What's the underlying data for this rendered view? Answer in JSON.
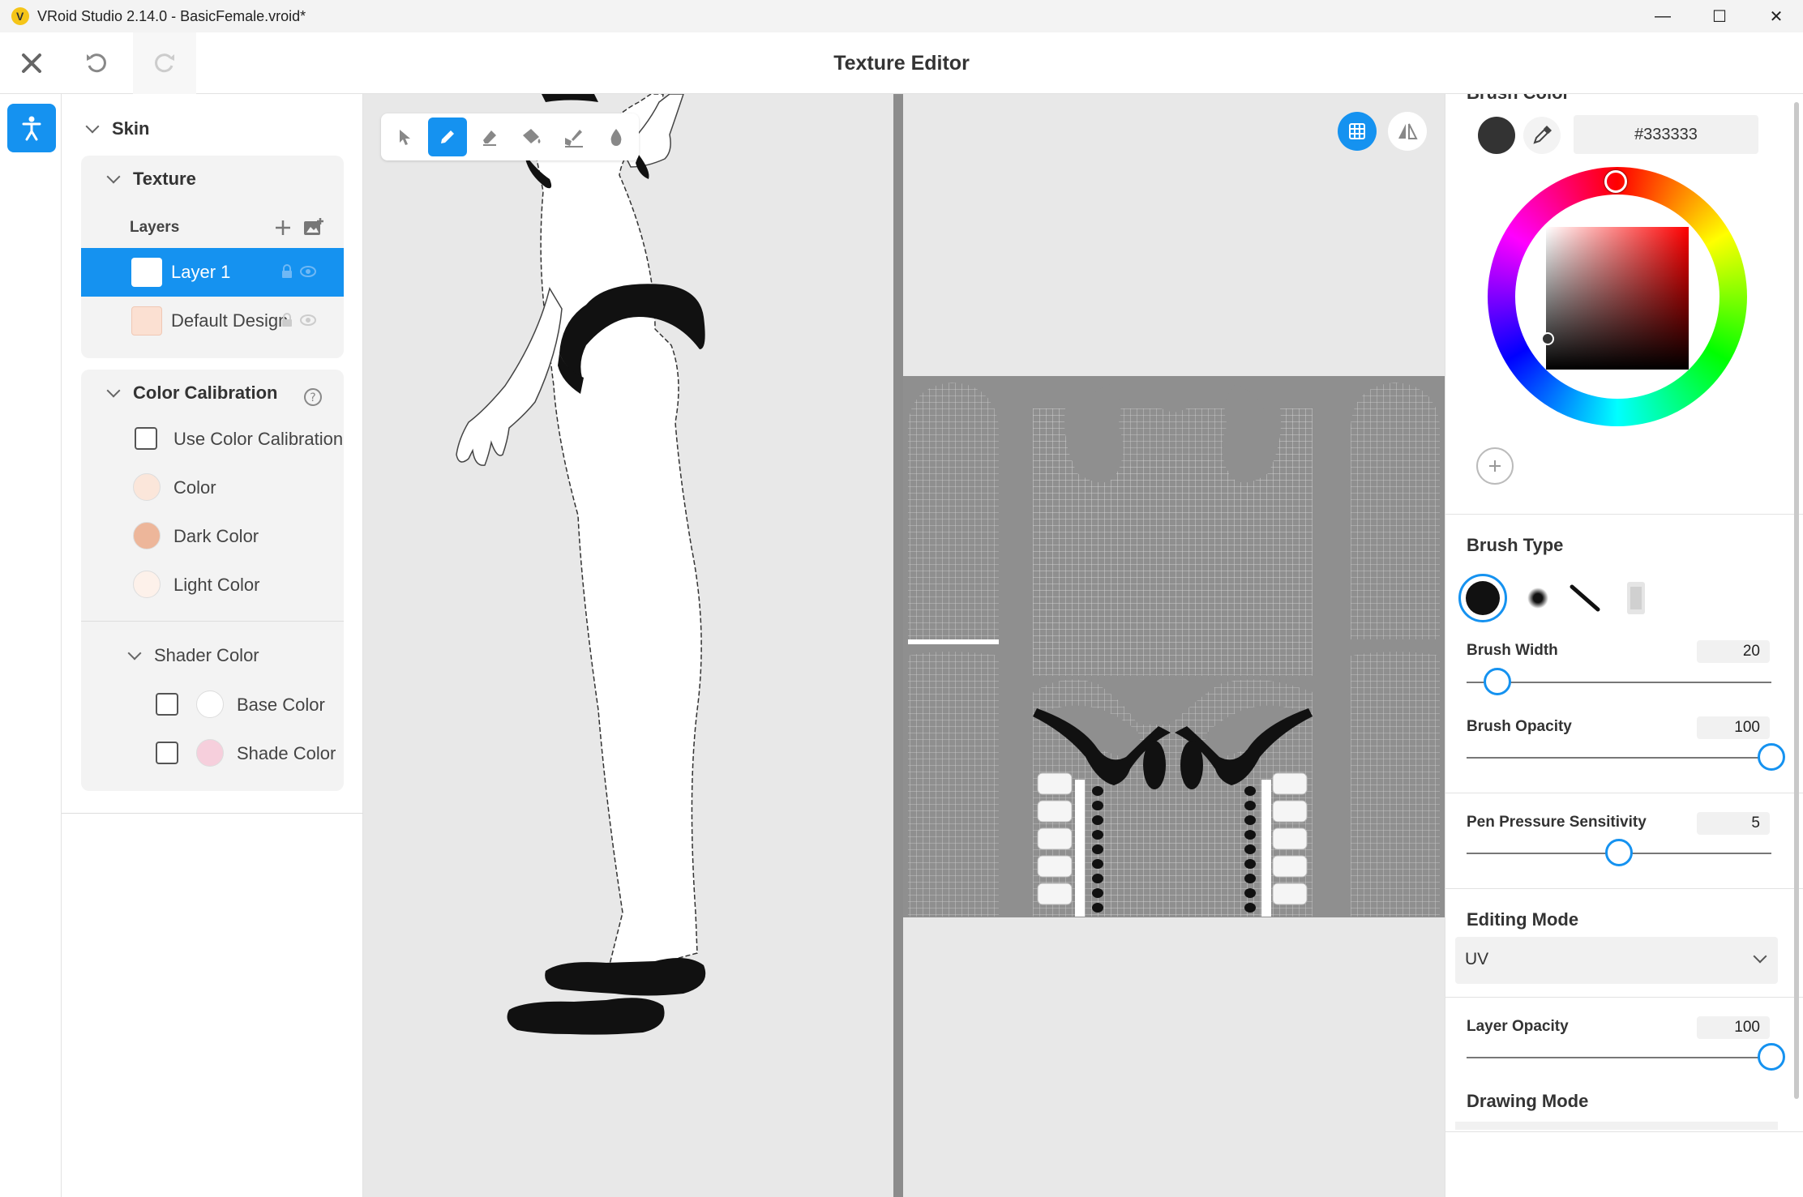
{
  "window": {
    "title": "VRoid Studio 2.14.0 - BasicFemale.vroid*",
    "minimize_glyph": "—",
    "maximize_glyph": "☐",
    "close_glyph": "✕"
  },
  "header": {
    "title": "Texture Editor"
  },
  "left_panel": {
    "skin_label": "Skin",
    "texture_label": "Texture",
    "layers_label": "Layers",
    "layers": [
      {
        "label": "Layer 1",
        "active": true
      },
      {
        "label": "Default Design",
        "active": false
      }
    ],
    "color_calibration_label": "Color Calibration",
    "use_color_calibration_label": "Use Color Calibration",
    "calibration_colors": [
      {
        "label": "Color",
        "color": "#fbe6da"
      },
      {
        "label": "Dark Color",
        "color": "#edb69a"
      },
      {
        "label": "Light Color",
        "color": "#fdf1ea"
      }
    ],
    "shader_color_label": "Shader Color",
    "shader_colors": [
      {
        "label": "Base Color",
        "color": "#ffffff"
      },
      {
        "label": "Shade Color",
        "color": "#f6cfdc"
      }
    ]
  },
  "right_panel": {
    "brush_color_label": "Brush Color",
    "brush_color_hex": "#333333",
    "brush_type_label": "Brush Type",
    "brush_width_label": "Brush Width",
    "brush_width_value": "20",
    "brush_width_fraction": 0.1,
    "brush_opacity_label": "Brush Opacity",
    "brush_opacity_value": "100",
    "brush_opacity_fraction": 1.0,
    "pen_pressure_label": "Pen Pressure Sensitivity",
    "pen_pressure_value": "5",
    "pen_pressure_fraction": 0.5,
    "editing_mode_label": "Editing Mode",
    "editing_mode_value": "UV",
    "layer_opacity_label": "Layer Opacity",
    "layer_opacity_value": "100",
    "layer_opacity_fraction": 1.0,
    "drawing_mode_label": "Drawing Mode"
  },
  "colors": {
    "accent": "#1592f0",
    "brush": "#333333"
  }
}
